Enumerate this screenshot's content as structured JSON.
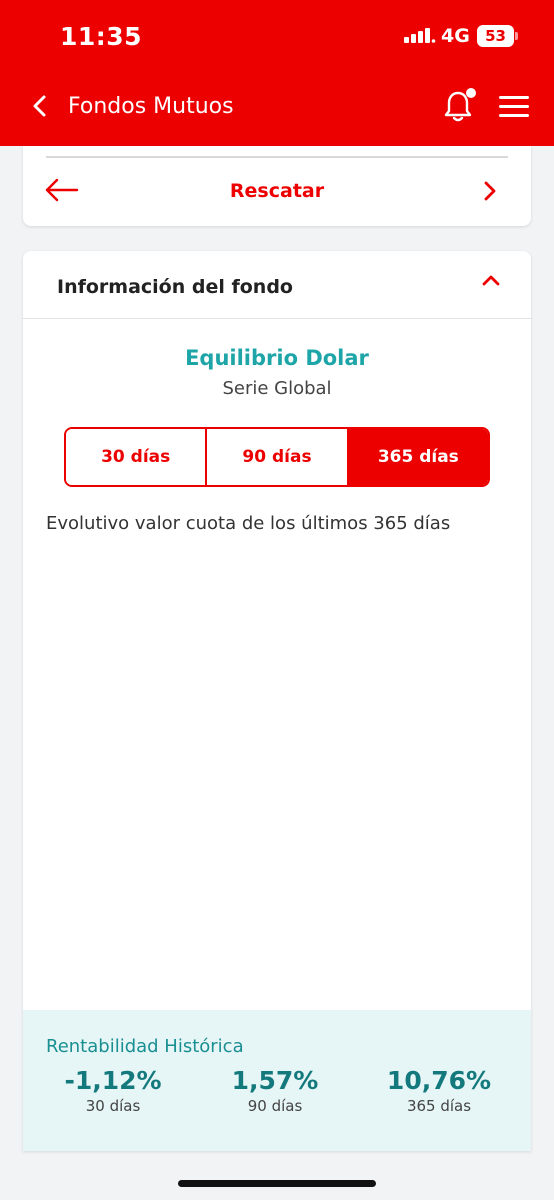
{
  "status_bar": {
    "time": "11:35",
    "network": "4G",
    "battery": "53"
  },
  "nav": {
    "title": "Fondos Mutuos"
  },
  "action": {
    "label": "Rescatar"
  },
  "info": {
    "title": "Información del fondo",
    "fund_name": "Equilibrio Dolar",
    "series": "Serie Global",
    "periods": [
      {
        "label": "30 días",
        "active": false
      },
      {
        "label": "90 días",
        "active": false
      },
      {
        "label": "365 días",
        "active": true
      }
    ],
    "chart_caption": "Evolutivo valor cuota de los últimos 365 días"
  },
  "returns": {
    "title": "Rentabilidad Histórica",
    "items": [
      {
        "value": "-1,12%",
        "label": "30 días"
      },
      {
        "value": "1,57%",
        "label": "90 días"
      },
      {
        "value": "10,76%",
        "label": "365 días"
      }
    ]
  },
  "colors": {
    "brand_red": "#ec0000",
    "teal": "#1ea5a8",
    "returns_bg": "#e6f5f6"
  }
}
